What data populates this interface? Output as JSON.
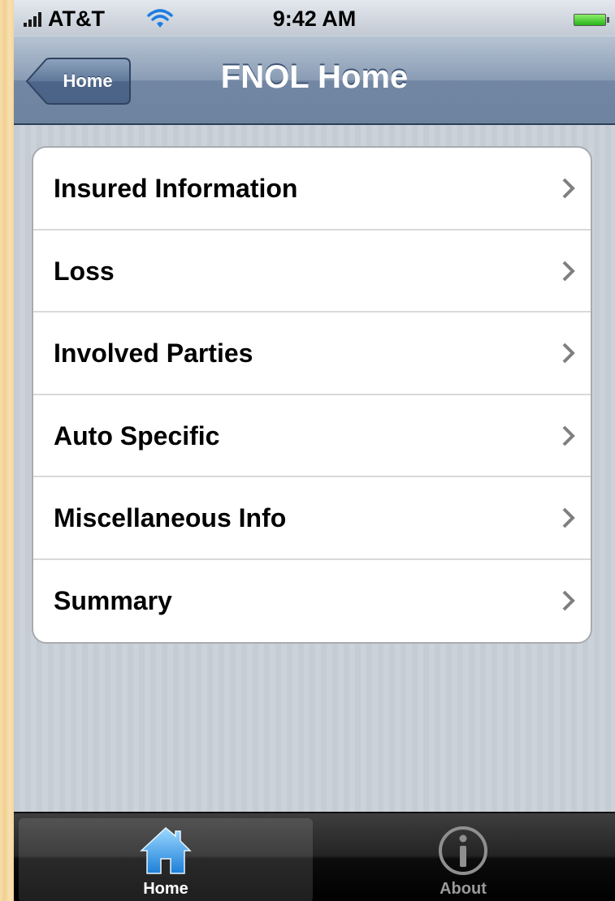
{
  "status_bar": {
    "carrier": "AT&T",
    "time": "9:42 AM",
    "battery_color": "#3fd12a"
  },
  "nav_bar": {
    "back_label": "Home",
    "title": "FNOL Home"
  },
  "menu": {
    "items": [
      {
        "label": "Insured Information"
      },
      {
        "label": "Loss"
      },
      {
        "label": "Involved Parties"
      },
      {
        "label": "Auto Specific"
      },
      {
        "label": "Miscellaneous Info"
      },
      {
        "label": "Summary"
      }
    ]
  },
  "tab_bar": {
    "tabs": [
      {
        "label": "Home",
        "icon": "home-icon",
        "selected": true
      },
      {
        "label": "About",
        "icon": "info-icon",
        "selected": false
      }
    ]
  },
  "colors": {
    "nav_accent": "#6d83a0",
    "content_bg": "#c5ccd4",
    "selected_icon": "#2e95e6"
  }
}
